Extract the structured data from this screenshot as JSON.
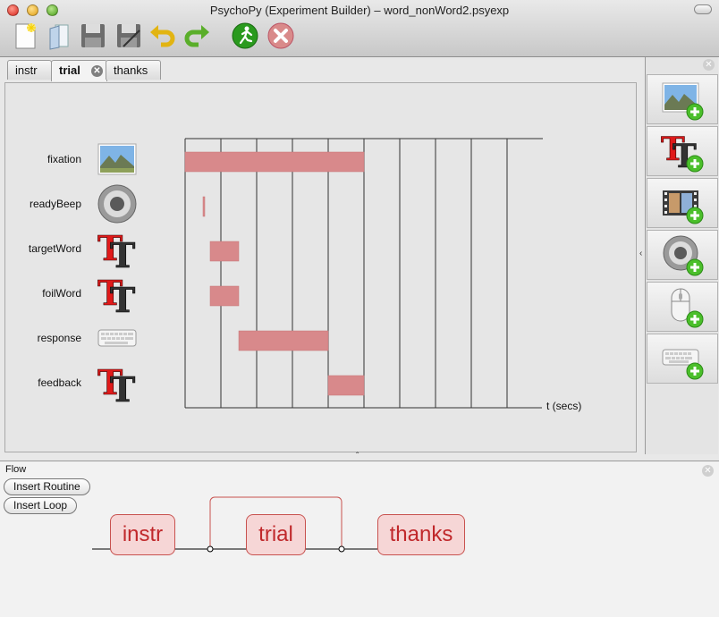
{
  "window": {
    "title": "PsychoPy (Experiment Builder) – word_nonWord2.psyexp"
  },
  "toolbar": {
    "buttons": [
      {
        "name": "new-file-icon"
      },
      {
        "name": "open-file-icon"
      },
      {
        "name": "save-icon"
      },
      {
        "name": "save-as-icon"
      },
      {
        "name": "undo-icon"
      },
      {
        "name": "redo-icon"
      },
      {
        "name": "run-icon"
      },
      {
        "name": "stop-icon"
      }
    ]
  },
  "tabs": [
    {
      "label": "instr"
    },
    {
      "label": "trial",
      "active": true
    },
    {
      "label": "thanks"
    }
  ],
  "routine": {
    "components": [
      {
        "label": "fixation",
        "icon": "image-icon"
      },
      {
        "label": "readyBeep",
        "icon": "speaker-icon"
      },
      {
        "label": "targetWord",
        "icon": "text-icon"
      },
      {
        "label": "foilWord",
        "icon": "text-icon"
      },
      {
        "label": "response",
        "icon": "keyboard-icon"
      },
      {
        "label": "feedback",
        "icon": "text-icon"
      }
    ],
    "timeline": {
      "xlabel": "t (secs)",
      "major_lines": 10,
      "bars": [
        {
          "component": "fixation",
          "start": 0.0,
          "stop": 5.0
        },
        {
          "component": "readyBeep",
          "start": 0.5,
          "stop": 0.55
        },
        {
          "component": "targetWord",
          "start": 0.7,
          "stop": 1.5
        },
        {
          "component": "foilWord",
          "start": 0.7,
          "stop": 1.5
        },
        {
          "component": "response",
          "start": 1.5,
          "stop": 4.0
        },
        {
          "component": "feedback",
          "start": 4.0,
          "stop": 5.0
        }
      ],
      "bar_color": "#d8898b"
    }
  },
  "components_panel": {
    "items": [
      {
        "name": "add-image-component"
      },
      {
        "name": "add-text-component"
      },
      {
        "name": "add-movie-component"
      },
      {
        "name": "add-sound-component"
      },
      {
        "name": "add-mouse-component"
      },
      {
        "name": "add-keyboard-component"
      }
    ]
  },
  "flow": {
    "title": "Flow",
    "insert_routine": "Insert Routine",
    "insert_loop": "Insert Loop",
    "routines": [
      "instr",
      "trial",
      "thanks"
    ],
    "accent": "#c0282b"
  }
}
